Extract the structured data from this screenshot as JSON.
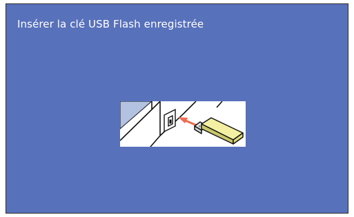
{
  "screen": {
    "instruction": "Insérer la clé USB Flash enregistrée",
    "background_color": "#5871bb",
    "text_color": "#ffffff"
  },
  "illustration": {
    "semantic": "usb-insert-illustration",
    "icons": [
      "usb-port-icon",
      "arrow-icon",
      "usb-flash-drive-icon"
    ],
    "colors": {
      "panel_shade": "#b3c2e1",
      "arrow": "#f26a4f",
      "drive_body": "#f3f0a3",
      "drive_shadow": "#c9c86a",
      "drive_connector": "#e4e4e4"
    }
  }
}
